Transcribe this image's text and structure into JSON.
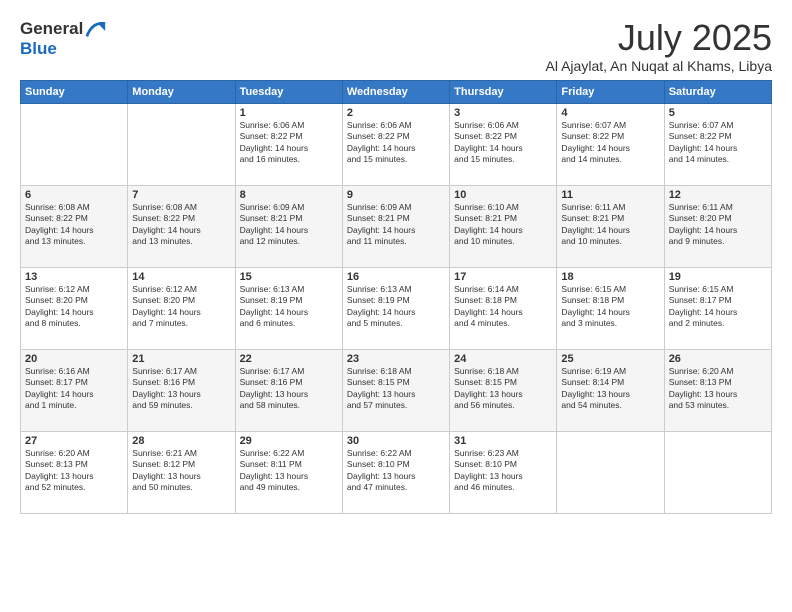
{
  "header": {
    "logo_line1": "General",
    "logo_line2": "Blue",
    "month": "July 2025",
    "location": "Al Ajaylat, An Nuqat al Khams, Libya"
  },
  "weekdays": [
    "Sunday",
    "Monday",
    "Tuesday",
    "Wednesday",
    "Thursday",
    "Friday",
    "Saturday"
  ],
  "weeks": [
    [
      {
        "day": "",
        "lines": []
      },
      {
        "day": "",
        "lines": []
      },
      {
        "day": "1",
        "lines": [
          "Sunrise: 6:06 AM",
          "Sunset: 8:22 PM",
          "Daylight: 14 hours",
          "and 16 minutes."
        ]
      },
      {
        "day": "2",
        "lines": [
          "Sunrise: 6:06 AM",
          "Sunset: 8:22 PM",
          "Daylight: 14 hours",
          "and 15 minutes."
        ]
      },
      {
        "day": "3",
        "lines": [
          "Sunrise: 6:06 AM",
          "Sunset: 8:22 PM",
          "Daylight: 14 hours",
          "and 15 minutes."
        ]
      },
      {
        "day": "4",
        "lines": [
          "Sunrise: 6:07 AM",
          "Sunset: 8:22 PM",
          "Daylight: 14 hours",
          "and 14 minutes."
        ]
      },
      {
        "day": "5",
        "lines": [
          "Sunrise: 6:07 AM",
          "Sunset: 8:22 PM",
          "Daylight: 14 hours",
          "and 14 minutes."
        ]
      }
    ],
    [
      {
        "day": "6",
        "lines": [
          "Sunrise: 6:08 AM",
          "Sunset: 8:22 PM",
          "Daylight: 14 hours",
          "and 13 minutes."
        ]
      },
      {
        "day": "7",
        "lines": [
          "Sunrise: 6:08 AM",
          "Sunset: 8:22 PM",
          "Daylight: 14 hours",
          "and 13 minutes."
        ]
      },
      {
        "day": "8",
        "lines": [
          "Sunrise: 6:09 AM",
          "Sunset: 8:21 PM",
          "Daylight: 14 hours",
          "and 12 minutes."
        ]
      },
      {
        "day": "9",
        "lines": [
          "Sunrise: 6:09 AM",
          "Sunset: 8:21 PM",
          "Daylight: 14 hours",
          "and 11 minutes."
        ]
      },
      {
        "day": "10",
        "lines": [
          "Sunrise: 6:10 AM",
          "Sunset: 8:21 PM",
          "Daylight: 14 hours",
          "and 10 minutes."
        ]
      },
      {
        "day": "11",
        "lines": [
          "Sunrise: 6:11 AM",
          "Sunset: 8:21 PM",
          "Daylight: 14 hours",
          "and 10 minutes."
        ]
      },
      {
        "day": "12",
        "lines": [
          "Sunrise: 6:11 AM",
          "Sunset: 8:20 PM",
          "Daylight: 14 hours",
          "and 9 minutes."
        ]
      }
    ],
    [
      {
        "day": "13",
        "lines": [
          "Sunrise: 6:12 AM",
          "Sunset: 8:20 PM",
          "Daylight: 14 hours",
          "and 8 minutes."
        ]
      },
      {
        "day": "14",
        "lines": [
          "Sunrise: 6:12 AM",
          "Sunset: 8:20 PM",
          "Daylight: 14 hours",
          "and 7 minutes."
        ]
      },
      {
        "day": "15",
        "lines": [
          "Sunrise: 6:13 AM",
          "Sunset: 8:19 PM",
          "Daylight: 14 hours",
          "and 6 minutes."
        ]
      },
      {
        "day": "16",
        "lines": [
          "Sunrise: 6:13 AM",
          "Sunset: 8:19 PM",
          "Daylight: 14 hours",
          "and 5 minutes."
        ]
      },
      {
        "day": "17",
        "lines": [
          "Sunrise: 6:14 AM",
          "Sunset: 8:18 PM",
          "Daylight: 14 hours",
          "and 4 minutes."
        ]
      },
      {
        "day": "18",
        "lines": [
          "Sunrise: 6:15 AM",
          "Sunset: 8:18 PM",
          "Daylight: 14 hours",
          "and 3 minutes."
        ]
      },
      {
        "day": "19",
        "lines": [
          "Sunrise: 6:15 AM",
          "Sunset: 8:17 PM",
          "Daylight: 14 hours",
          "and 2 minutes."
        ]
      }
    ],
    [
      {
        "day": "20",
        "lines": [
          "Sunrise: 6:16 AM",
          "Sunset: 8:17 PM",
          "Daylight: 14 hours",
          "and 1 minute."
        ]
      },
      {
        "day": "21",
        "lines": [
          "Sunrise: 6:17 AM",
          "Sunset: 8:16 PM",
          "Daylight: 13 hours",
          "and 59 minutes."
        ]
      },
      {
        "day": "22",
        "lines": [
          "Sunrise: 6:17 AM",
          "Sunset: 8:16 PM",
          "Daylight: 13 hours",
          "and 58 minutes."
        ]
      },
      {
        "day": "23",
        "lines": [
          "Sunrise: 6:18 AM",
          "Sunset: 8:15 PM",
          "Daylight: 13 hours",
          "and 57 minutes."
        ]
      },
      {
        "day": "24",
        "lines": [
          "Sunrise: 6:18 AM",
          "Sunset: 8:15 PM",
          "Daylight: 13 hours",
          "and 56 minutes."
        ]
      },
      {
        "day": "25",
        "lines": [
          "Sunrise: 6:19 AM",
          "Sunset: 8:14 PM",
          "Daylight: 13 hours",
          "and 54 minutes."
        ]
      },
      {
        "day": "26",
        "lines": [
          "Sunrise: 6:20 AM",
          "Sunset: 8:13 PM",
          "Daylight: 13 hours",
          "and 53 minutes."
        ]
      }
    ],
    [
      {
        "day": "27",
        "lines": [
          "Sunrise: 6:20 AM",
          "Sunset: 8:13 PM",
          "Daylight: 13 hours",
          "and 52 minutes."
        ]
      },
      {
        "day": "28",
        "lines": [
          "Sunrise: 6:21 AM",
          "Sunset: 8:12 PM",
          "Daylight: 13 hours",
          "and 50 minutes."
        ]
      },
      {
        "day": "29",
        "lines": [
          "Sunrise: 6:22 AM",
          "Sunset: 8:11 PM",
          "Daylight: 13 hours",
          "and 49 minutes."
        ]
      },
      {
        "day": "30",
        "lines": [
          "Sunrise: 6:22 AM",
          "Sunset: 8:10 PM",
          "Daylight: 13 hours",
          "and 47 minutes."
        ]
      },
      {
        "day": "31",
        "lines": [
          "Sunrise: 6:23 AM",
          "Sunset: 8:10 PM",
          "Daylight: 13 hours",
          "and 46 minutes."
        ]
      },
      {
        "day": "",
        "lines": []
      },
      {
        "day": "",
        "lines": []
      }
    ]
  ]
}
